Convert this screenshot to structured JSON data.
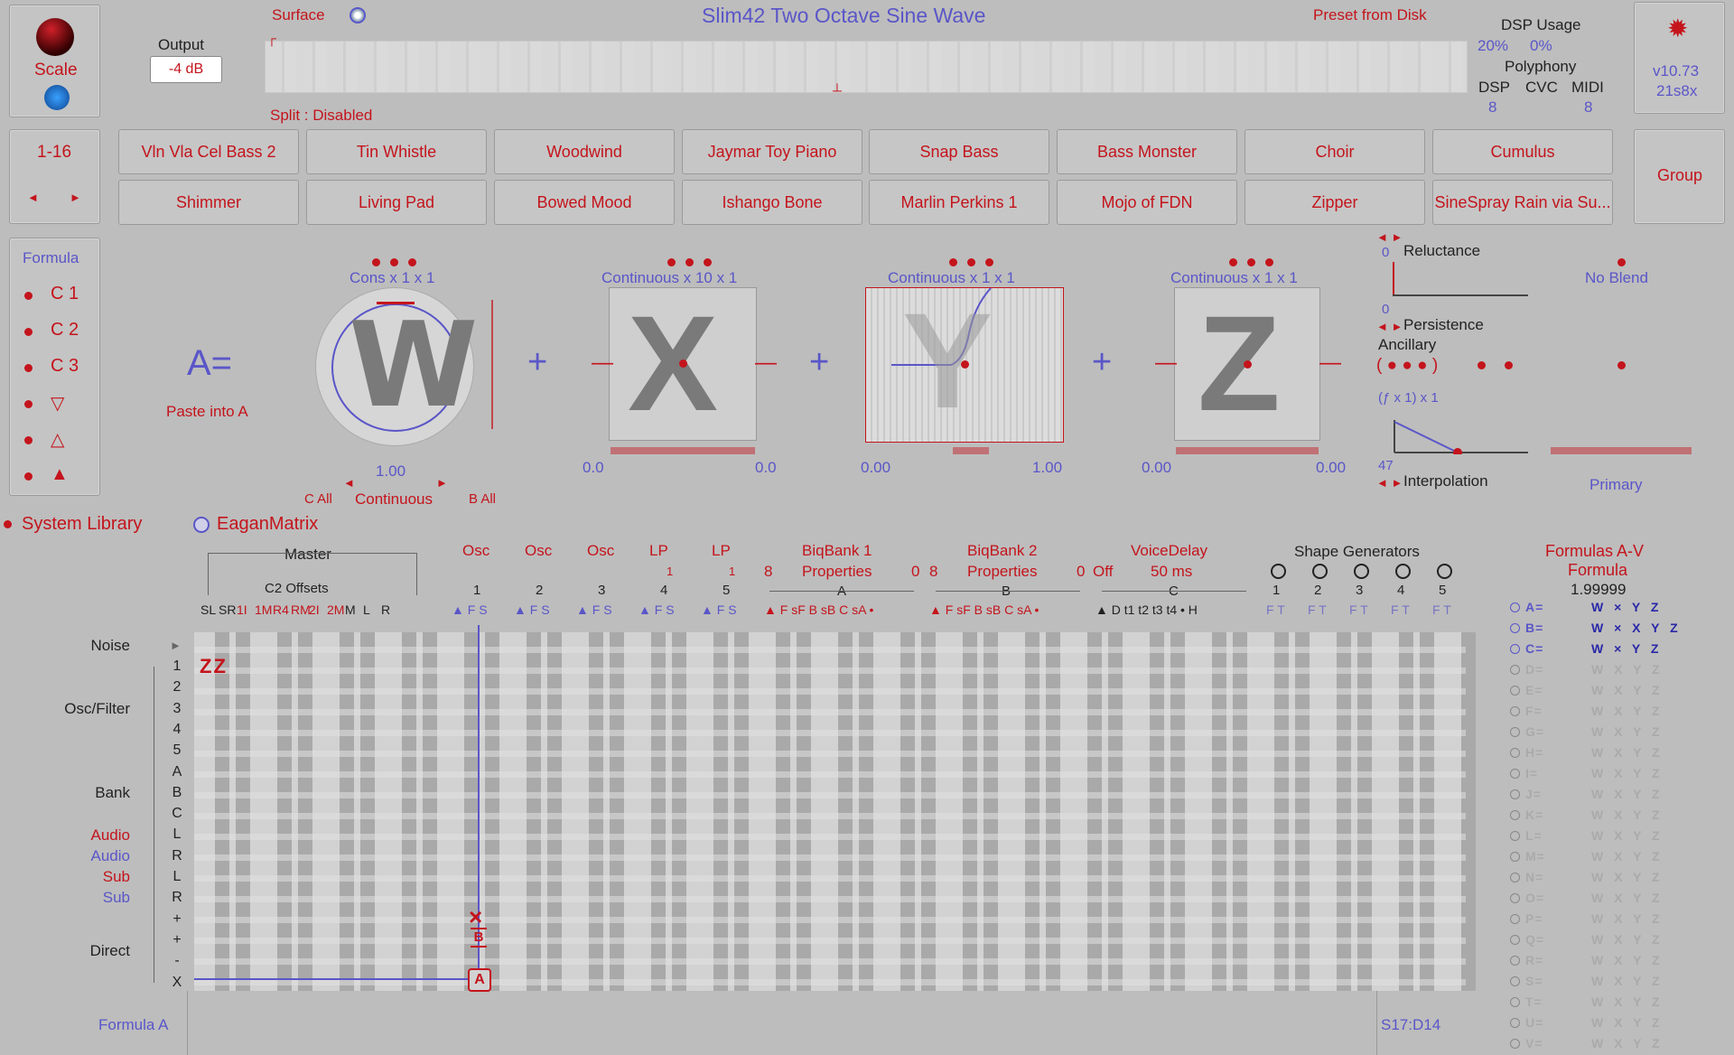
{
  "header": {
    "scale_label": "Scale",
    "output_label": "Output",
    "output_value": "-4 dB",
    "surface_label": "Surface",
    "preset_title": "Slim42 Two Octave Sine Wave",
    "preset_from_disk": "Preset from Disk",
    "split_label": "Split : Disabled",
    "dsp_usage_label": "DSP Usage",
    "dsp_usage_1": "20%",
    "dsp_usage_2": "0%",
    "polyphony_label": "Polyphony",
    "poly_dsp_label": "DSP",
    "poly_cvc_label": "CVC",
    "poly_midi_label": "MIDI",
    "poly_dsp_value": "8",
    "poly_midi_value": "8",
    "version": "v10.73",
    "build": "21s8x"
  },
  "presets": {
    "range_label": "1-16",
    "prev_arrow": "◄",
    "next_arrow": "►",
    "row1": [
      "Vln Vla Cel Bass 2",
      "Tin Whistle",
      "Woodwind",
      "Jaymar Toy Piano",
      "Snap Bass",
      "Bass Monster",
      "Choir",
      "Cumulus"
    ],
    "row2": [
      "Shimmer",
      "Living Pad",
      "Bowed Mood",
      "Ishango Bone",
      "Marlin Perkins 1",
      "Mojo of FDN",
      "Zipper",
      "SineSpray Rain via Su..."
    ],
    "group_label": "Group"
  },
  "formula_panel": {
    "title": "Formula",
    "items": [
      "C 1",
      "C 2",
      "C 3",
      "▽",
      "△",
      "▲"
    ]
  },
  "formula_editor": {
    "a_equals": "A=",
    "paste_into_a": "Paste into A",
    "w_mode": "Cons x 1 x 1",
    "x_mode": "Continuous x 10 x 1",
    "y_mode": "Continuous x 1 x 1",
    "z_mode": "Continuous x 1 x 1",
    "w_value": "1.00",
    "call_label": "C All",
    "continuous_label": "Continuous",
    "ball_label": "B All",
    "x_low": "0.0",
    "x_high": "0.0",
    "y_low": "0.00",
    "y_high": "1.00",
    "z_low": "0.00",
    "z_high": "0.00",
    "plus": "+",
    "minus": "−",
    "reluctance_label": "Reluctance",
    "reluctance_top": "0",
    "reluctance_bottom": "0",
    "persistence_label": "Persistence",
    "ancillary_label": "Ancillary",
    "ancillary_expr": "( ● ● ● )",
    "fx_expr": "(ƒ x 1) x 1",
    "interp_value": "47",
    "interpolation_label": "Interpolation",
    "no_blend": "No Blend",
    "primary": "Primary"
  },
  "library": {
    "system_library": "System Library",
    "eaganmatrix": "EaganMatrix"
  },
  "matrix": {
    "master_label": "Master",
    "c2_offsets_label": "C2 Offsets",
    "master_cols": [
      "SL",
      "SR",
      "1I",
      "1M",
      "R4",
      "RM",
      "2I",
      "2M",
      "M",
      "L",
      "R"
    ],
    "osc_groups": [
      {
        "title": "Osc",
        "num": "1",
        "sub": ""
      },
      {
        "title": "Osc",
        "num": "2",
        "sub": ""
      },
      {
        "title": "Osc",
        "num": "3",
        "sub": ""
      },
      {
        "title": "LP",
        "num": "4",
        "sub": "1"
      },
      {
        "title": "LP",
        "num": "5",
        "sub": "1"
      }
    ],
    "bank1_title": "BiqBank 1",
    "bank1_props": "Properties",
    "bank1_count": "8",
    "bank1_letter": "A",
    "bank2_title": "BiqBank 2",
    "bank2_props": "Properties",
    "bank2_pre": "0",
    "bank2_count": "8",
    "bank2_letter": "B",
    "voicedelay_title": "VoiceDelay",
    "voicedelay_value": "50 ms",
    "voicedelay_pre": "0",
    "voicedelay_off": "Off",
    "voicedelay_letter": "C",
    "shape_gen_title": "Shape Generators",
    "shape_nums": [
      "1",
      "2",
      "3",
      "4",
      "5"
    ],
    "osc_cols": "▲ F S",
    "bank_cols": "▲ F sF B sB C sA •",
    "vd_cols": "▲ D t1 t2 t3 t4 • H",
    "sg_cols": "F T",
    "row_labels": {
      "noise": "Noise",
      "osc_filter": "Osc/Filter",
      "bank": "Bank",
      "audio1": "Audio",
      "audio2": "Audio",
      "sub1": "Sub",
      "sub2": "Sub",
      "direct": "Direct"
    },
    "row_nums": [
      "1",
      "2",
      "3",
      "4",
      "5",
      "A",
      "B",
      "C",
      "L",
      "R",
      "L",
      "R",
      "+",
      "+",
      "-",
      "X"
    ],
    "zz_marker": "Z Z",
    "cell_x": "×",
    "cell_b": "B",
    "cell_a": "A",
    "formula_a_label": "Formula A",
    "status": "S17:D14"
  },
  "formulas": {
    "title1": "Formulas A-V",
    "title2": "Formula",
    "value": "1.99999",
    "rows": [
      {
        "letter": "A=",
        "expr": "W × Y Z",
        "active": true
      },
      {
        "letter": "B=",
        "expr": "W × X Y Z",
        "active": true
      },
      {
        "letter": "C=",
        "expr": "W × Y Z",
        "active": true
      },
      {
        "letter": "D=",
        "expr": "W X Y Z",
        "active": false
      },
      {
        "letter": "E=",
        "expr": "W X Y Z",
        "active": false
      },
      {
        "letter": "F=",
        "expr": "W X Y Z",
        "active": false
      },
      {
        "letter": "G=",
        "expr": "W X Y Z",
        "active": false
      },
      {
        "letter": "H=",
        "expr": "W X Y Z",
        "active": false
      },
      {
        "letter": "I=",
        "expr": "W X Y Z",
        "active": false
      },
      {
        "letter": "J=",
        "expr": "W X Y Z",
        "active": false
      },
      {
        "letter": "K=",
        "expr": "W X Y Z",
        "active": false
      },
      {
        "letter": "L=",
        "expr": "W X Y Z",
        "active": false
      },
      {
        "letter": "M=",
        "expr": "W X Y Z",
        "active": false
      },
      {
        "letter": "N=",
        "expr": "W X Y Z",
        "active": false
      },
      {
        "letter": "O=",
        "expr": "W X Y Z",
        "active": false
      },
      {
        "letter": "P=",
        "expr": "W X Y Z",
        "active": false
      },
      {
        "letter": "Q=",
        "expr": "W X Y Z",
        "active": false
      },
      {
        "letter": "R=",
        "expr": "W X Y Z",
        "active": false
      },
      {
        "letter": "S=",
        "expr": "W X Y Z",
        "active": false
      },
      {
        "letter": "T=",
        "expr": "W X Y Z",
        "active": false
      },
      {
        "letter": "U=",
        "expr": "W X Y Z",
        "active": false
      },
      {
        "letter": "V=",
        "expr": "W X Y Z",
        "active": false
      }
    ]
  },
  "colors": {
    "accent_red": "#c4141c",
    "accent_blue": "#5a56c8",
    "background": "#bdbdbd"
  }
}
